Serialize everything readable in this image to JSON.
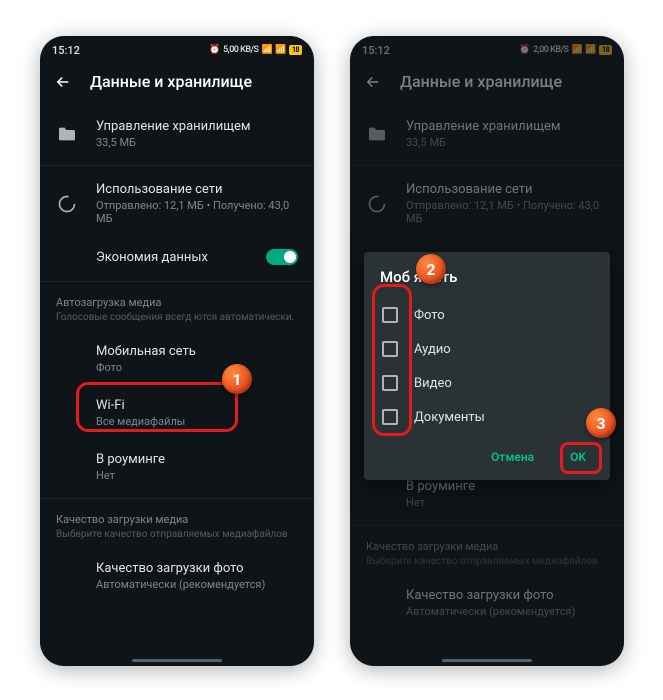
{
  "status": {
    "time": "15:12",
    "speed_left": "5,00",
    "speed_right": "2,00",
    "speed_unit": "KB/S",
    "battery": "18"
  },
  "appbar": {
    "title": "Данные и хранилище"
  },
  "storage": {
    "title": "Управление хранилищем",
    "sub": "33,5 МБ"
  },
  "network": {
    "title": "Использование сети",
    "sub": "Отправлено: 12,1 МБ • Получено: 43,0 МБ"
  },
  "datasaver": {
    "title": "Экономия данных"
  },
  "autodl": {
    "header": "Автозагрузка медиа",
    "desc_full": "Голосовые сообщения всегда загружаются автоматически.",
    "desc_cut": "Голосовые сообщения всегд         ются автоматически."
  },
  "mobile": {
    "title": "Мобильная сеть",
    "sub": "Фото"
  },
  "wifi": {
    "title": "Wi-Fi",
    "sub": "Все медиафайлы"
  },
  "roaming": {
    "title": "В роуминге",
    "sub": "Нет"
  },
  "quality": {
    "header": "Качество загрузки медиа",
    "desc": "Выберите качество отправляемых медиафайлов",
    "photo_title": "Качество загрузки фото",
    "photo_sub": "Автоматически (рекомендуется)"
  },
  "dialog": {
    "title_cut": "Моб           я сеть",
    "opts": [
      "Фото",
      "Аудио",
      "Видео",
      "Документы"
    ],
    "cancel": "Отмена",
    "ok": "OK"
  },
  "badges": {
    "b1": "1",
    "b2": "2",
    "b3": "3"
  }
}
